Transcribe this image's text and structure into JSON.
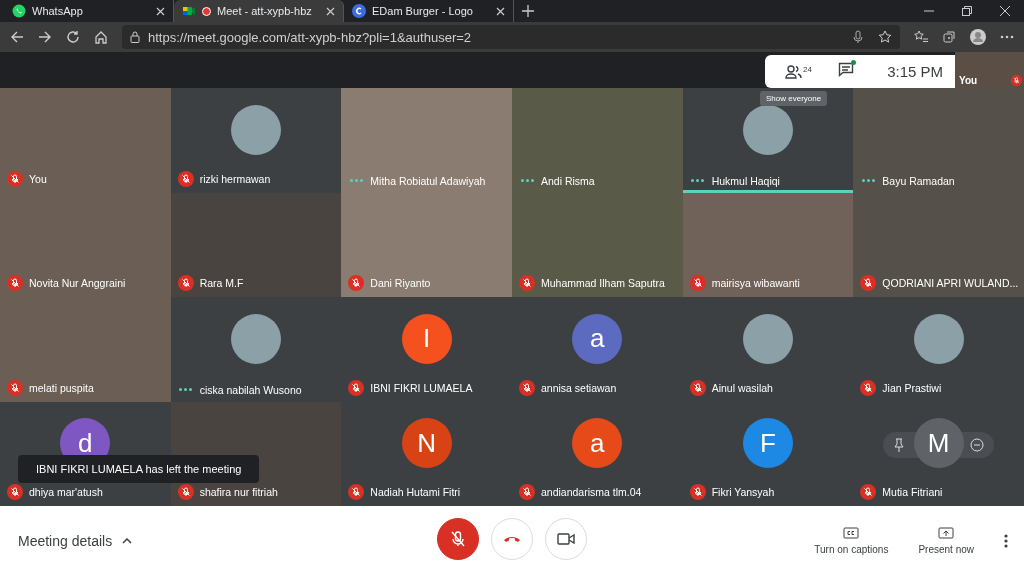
{
  "browser": {
    "tabs": [
      {
        "title": "WhatsApp",
        "selected": false,
        "recording": false
      },
      {
        "title": "Meet - att-xypb-hbz",
        "selected": true,
        "recording": true
      },
      {
        "title": "EDam Burger - Logo",
        "selected": false,
        "recording": false
      }
    ],
    "url": "https://meet.google.com/att-xypb-hbz?pli=1&authuser=2"
  },
  "meeting": {
    "participant_count": "24",
    "time": "3:15 PM",
    "chat_unread": true,
    "tooltip": "Show everyone",
    "self_view": {
      "label": "You",
      "muted": true
    }
  },
  "tiles": [
    {
      "name": "You",
      "kind": "video",
      "muted": true,
      "speaking": false,
      "hovered": false
    },
    {
      "name": "rizki hermawan",
      "kind": "picture",
      "muted": true,
      "speaking": false,
      "hovered": false
    },
    {
      "name": "Mitha Robiatul Adawiyah",
      "kind": "video",
      "muted": false,
      "speaking": false,
      "hovered": false
    },
    {
      "name": "Andi Risma",
      "kind": "video",
      "muted": false,
      "speaking": false,
      "hovered": false
    },
    {
      "name": "Hukmul Haqiqi",
      "kind": "picture",
      "muted": false,
      "speaking": true,
      "hovered": false
    },
    {
      "name": "Bayu Ramadan",
      "kind": "video",
      "muted": false,
      "speaking": false,
      "hovered": false
    },
    {
      "name": "Novita Nur Anggraini",
      "kind": "video",
      "muted": true,
      "speaking": false,
      "hovered": false
    },
    {
      "name": "Rara M.F",
      "kind": "video",
      "muted": true,
      "speaking": false,
      "hovered": false
    },
    {
      "name": "Dani Riyanto",
      "kind": "video",
      "muted": true,
      "speaking": false,
      "hovered": false
    },
    {
      "name": "Muhammad Ilham Saputra",
      "kind": "video",
      "muted": true,
      "speaking": false,
      "hovered": false
    },
    {
      "name": "mairisya wibawanti",
      "kind": "video",
      "muted": true,
      "speaking": false,
      "hovered": false
    },
    {
      "name": "QODRIANI APRI WULAND...",
      "kind": "video",
      "muted": true,
      "speaking": false,
      "hovered": false
    },
    {
      "name": "melati puspita",
      "kind": "video",
      "muted": true,
      "speaking": false,
      "hovered": false
    },
    {
      "name": "ciska nabilah Wusono",
      "kind": "picture",
      "muted": false,
      "speaking": false,
      "hovered": false
    },
    {
      "name": "IBNI FIKRI LUMAELA",
      "kind": "avatar",
      "letter": "I",
      "color": "#f4511e",
      "muted": true,
      "speaking": false,
      "hovered": false
    },
    {
      "name": "annisa setiawan",
      "kind": "avatar",
      "letter": "a",
      "color": "#5c6bc0",
      "muted": true,
      "speaking": false,
      "hovered": false
    },
    {
      "name": "Ainul wasilah",
      "kind": "picture",
      "muted": true,
      "speaking": false,
      "hovered": false
    },
    {
      "name": "Jian Prastiwi",
      "kind": "picture",
      "muted": true,
      "speaking": false,
      "hovered": false
    },
    {
      "name": "dhiya mar'atush",
      "kind": "avatar",
      "letter": "d",
      "color": "#7e57c2",
      "muted": true,
      "speaking": false,
      "hovered": false
    },
    {
      "name": "shafira nur fitriah",
      "kind": "video",
      "muted": true,
      "speaking": false,
      "hovered": false
    },
    {
      "name": "Nadiah Hutami Fitri",
      "kind": "avatar",
      "letter": "N",
      "color": "#d84315",
      "muted": true,
      "speaking": false,
      "hovered": false
    },
    {
      "name": "andiandarisma tlm.04",
      "kind": "avatar",
      "letter": "a",
      "color": "#e64a19",
      "muted": true,
      "speaking": false,
      "hovered": false
    },
    {
      "name": "Fikri Yansyah",
      "kind": "avatar",
      "letter": "F",
      "color": "#1e88e5",
      "muted": true,
      "speaking": false,
      "hovered": false
    },
    {
      "name": "Mutia Fitriani",
      "kind": "avatar",
      "letter": "M",
      "color": "#5f6368",
      "muted": true,
      "speaking": false,
      "hovered": true
    }
  ],
  "toast": "IBNI FIKRI LUMAELA has left the meeting",
  "controls": {
    "meeting_details": "Meeting details",
    "mic_muted": true,
    "camera_off": false,
    "captions": "Turn on captions",
    "present": "Present now"
  }
}
